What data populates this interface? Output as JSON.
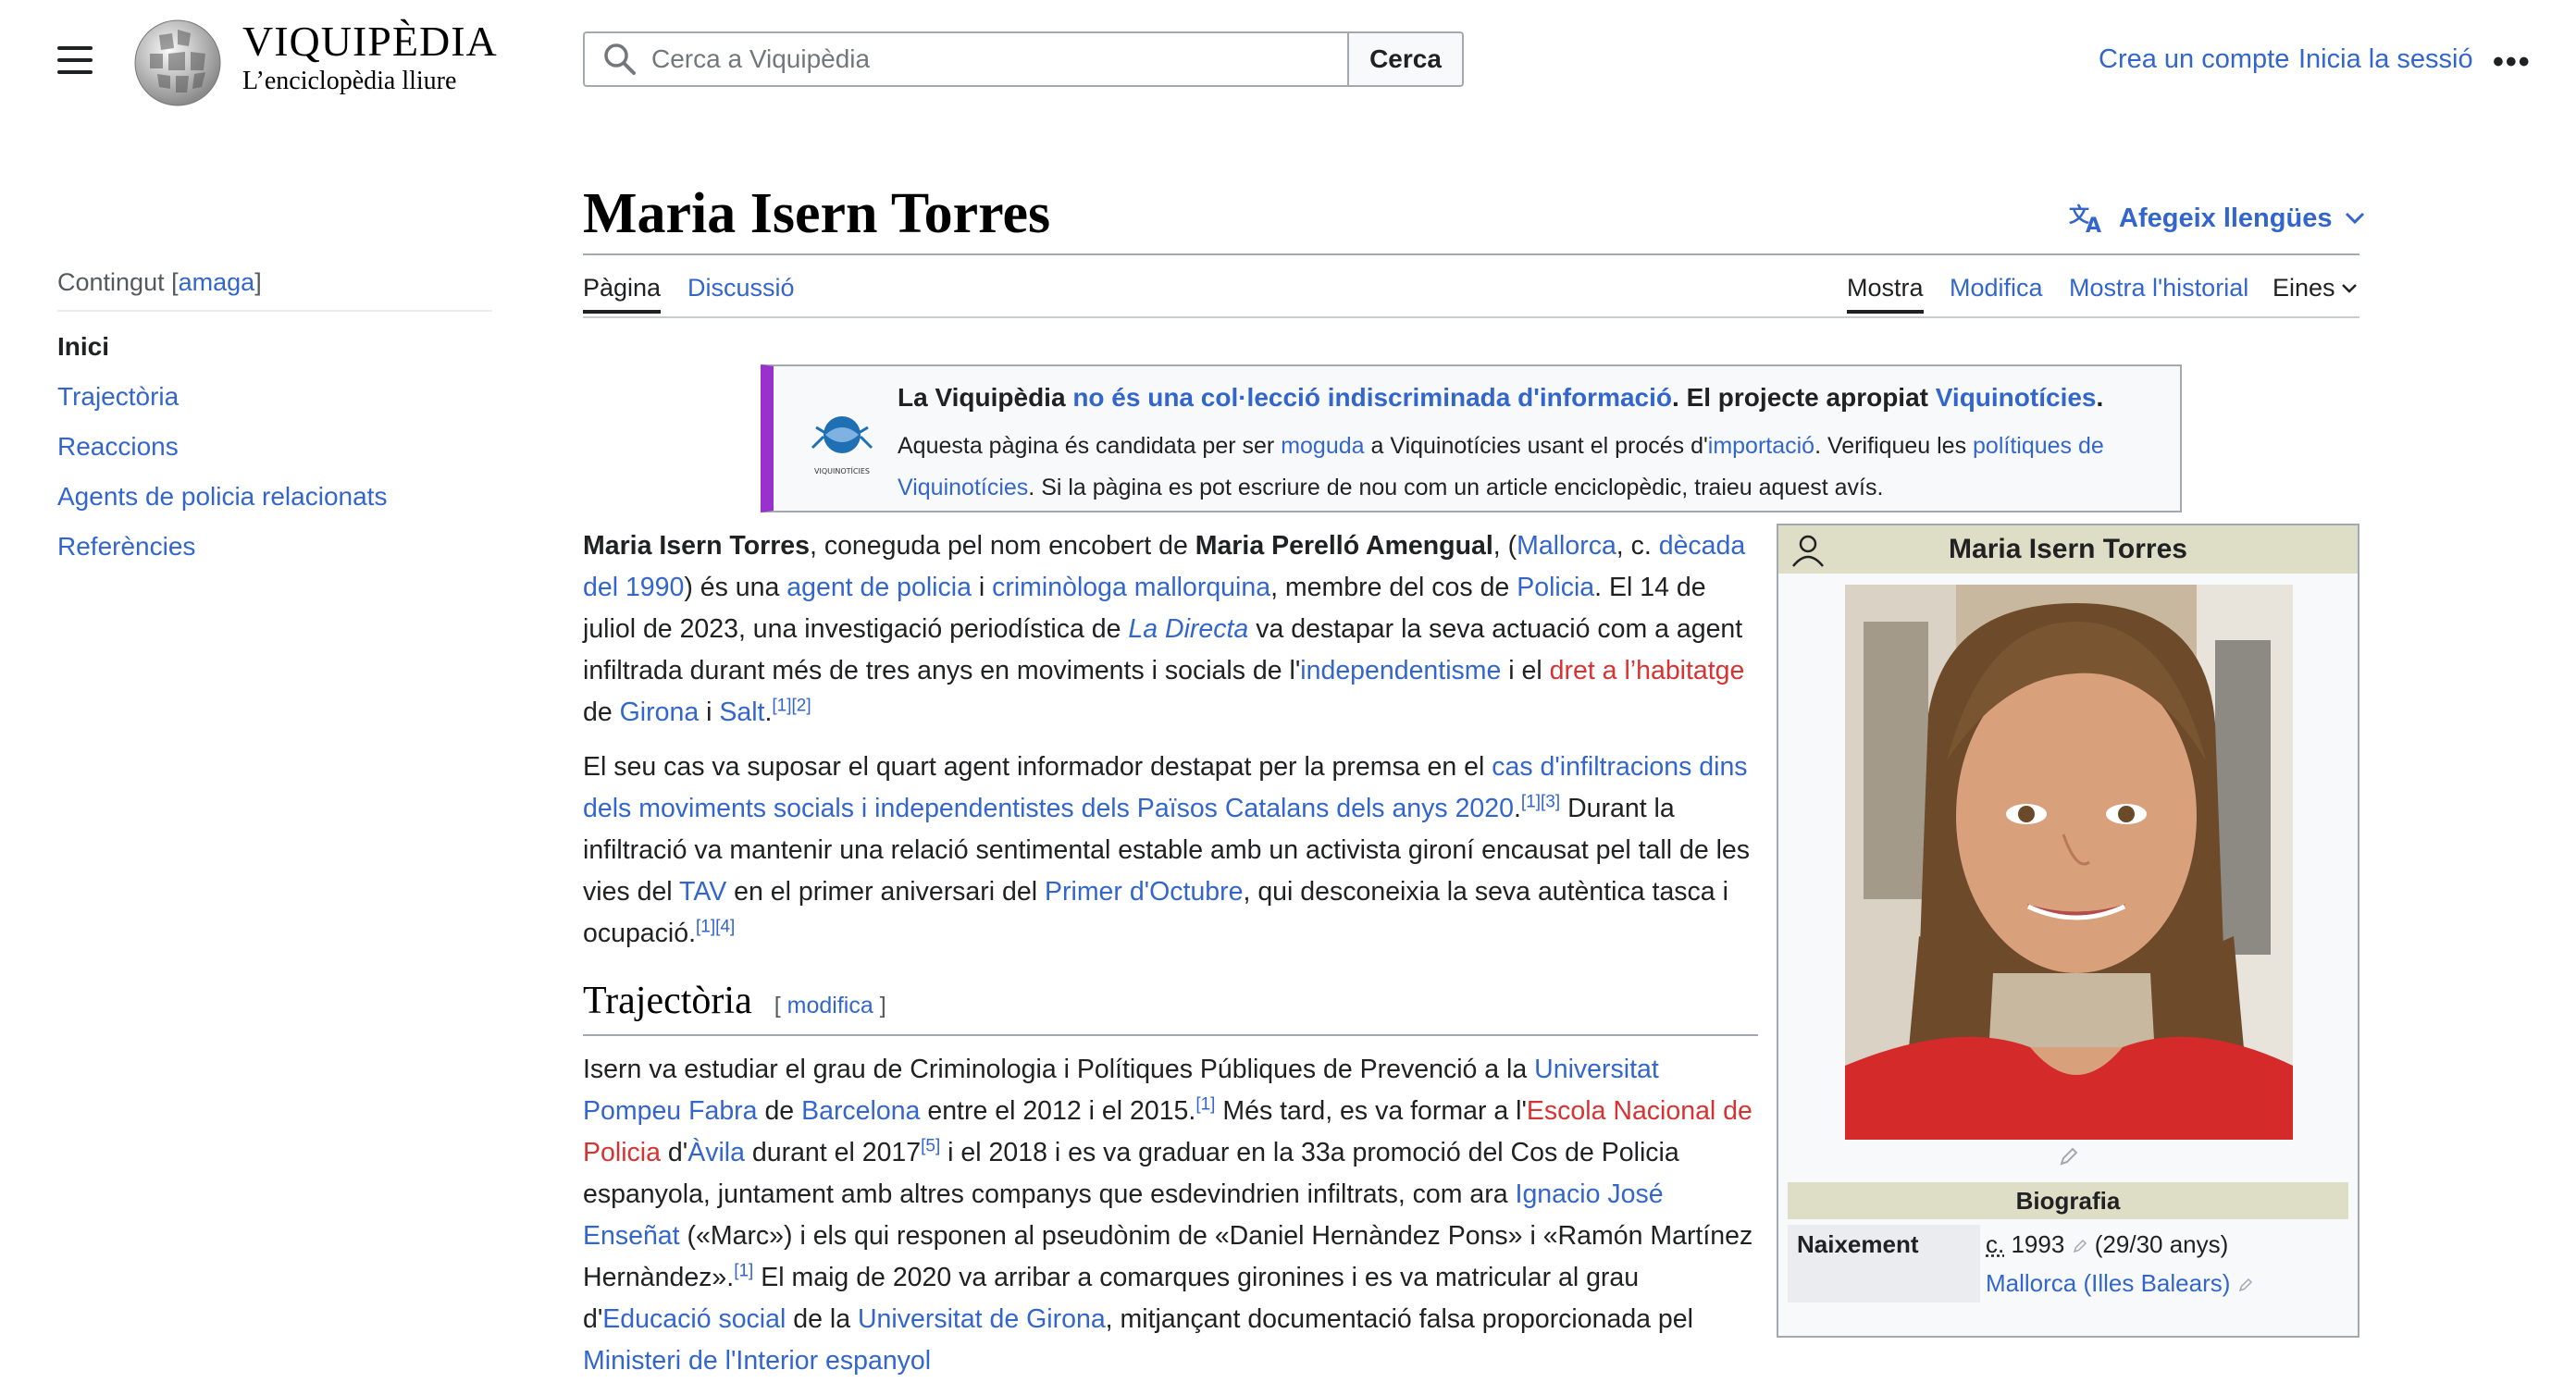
{
  "header": {
    "logo_title": "VIQUIPÈDIA",
    "logo_subtitle": "L’enciclopèdia lliure",
    "search_placeholder": "Cerca a Viquipèdia",
    "search_button": "Cerca",
    "create_account": "Crea un compte",
    "login": "Inicia la sessió",
    "more": "•••"
  },
  "toc": {
    "heading": "Contingut",
    "hide_open": "[",
    "hide": "amaga",
    "hide_close": "]",
    "items": [
      {
        "label": "Inici"
      },
      {
        "label": "Trajectòria"
      },
      {
        "label": "Reaccions"
      },
      {
        "label": "Agents de policia relacionats"
      },
      {
        "label": "Referències"
      }
    ]
  },
  "page": {
    "title": "Maria Isern Torres",
    "add_languages": "Afegeix llengües",
    "tabs": {
      "page": "Pàgina",
      "talk": "Discussió",
      "read": "Mostra",
      "edit": "Modifica",
      "history": "Mostra l'historial",
      "tools": "Eines"
    }
  },
  "notice": {
    "logo_text": "VIQUINOTÍCIES",
    "l1_a": "La Viquipèdia ",
    "l1_link": "no és una col·lecció indiscriminada d'informació",
    "l1_b": ". El projecte apropiat ",
    "l1_link2": "Viquinotícies",
    "l1_c": ".",
    "l2_a": "Aquesta pàgina és candidata per ser ",
    "l2_link1": "moguda",
    "l2_b": " a Viquinotícies usant el procés d'",
    "l2_link2": "importació",
    "l2_c": ". Verifiqueu les ",
    "l2_link3": "polítiques de Viquinotícies",
    "l2_d": ". Si la pàgina es pot escriure de nou com un article enciclopèdic, traieu aquest avís."
  },
  "p1": {
    "b1": "Maria Isern Torres",
    "t1": ", coneguda pel nom encobert de ",
    "b2": "Maria Perelló Amengual",
    "t2": ", (",
    "l1": "Mallorca",
    "t3": ", c. ",
    "l2": "dècada del 1990",
    "t4": ") és una ",
    "l3": "agent de policia",
    "t5": " i ",
    "l4": "criminòloga mallorquina",
    "t6": ", membre del cos de ",
    "l5": "Policia",
    "t7": ". El 14 de juliol de 2023, una investigació periodística de ",
    "l6": "La Directa",
    "t8": " va destapar la seva actuació com a agent infiltrada durant més de tres anys en moviments i socials de l'",
    "l7": "independentisme",
    "t9": " i el ",
    "r1": "dret a l’habitatge",
    "t10": " de ",
    "l8": "Girona",
    "t11": " i ",
    "l9": "Salt",
    "t12": ".",
    "s1": "[1]",
    "s2": "[2]"
  },
  "p2": {
    "t1": "El seu cas va suposar el quart agent informador destapat per la premsa en el ",
    "l1": "cas d'infiltracions dins dels moviments socials i independentistes dels Països Catalans dels anys 2020",
    "t2": ".",
    "s1": "[1]",
    "s2": "[3]",
    "t3": " Durant la infiltració va mantenir una relació sentimental estable amb un activista gironí encausat pel tall de les vies del ",
    "l2": "TAV",
    "t4": " en el primer aniversari del ",
    "l3": "Primer d'Octubre",
    "t5": ", qui desconeixia la seva autèntica tasca i ocupació.",
    "s3": "[1]",
    "s4": "[4]"
  },
  "section1": {
    "title": "Trajectòria",
    "edit_open": "[",
    "edit": "modifica",
    "edit_close": "]"
  },
  "p3": {
    "t1": "Isern va estudiar el grau de Criminologia i Polítiques Públiques de Prevenció a la ",
    "l1": "Universitat Pompeu Fabra",
    "t2": " de ",
    "l2": "Barcelona",
    "t3": " entre el 2012 i el 2015.",
    "s1": "[1]",
    "t4": " Més tard, es va formar a l'",
    "r1": "Escola Nacional de Policia",
    "t5": " d'",
    "l3": "Àvila",
    "t6": " durant el 2017",
    "s2": "[5]",
    "t7": " i el 2018 i es va graduar en la 33a promoció del Cos de Policia espanyola, juntament amb altres companys que esdevindrien infiltrats, com ara ",
    "l4": "Ignacio José Enseñat",
    "t8": " («Marc») i els qui responen al pseudònim de «Daniel Hernàndez Pons» i «Ramón Martínez Hernàndez».",
    "s3": "[1]",
    "t9": " El maig de 2020 va arribar a comarques gironines i es va matricular al grau d'",
    "l5": "Educació social",
    "t10": " de la ",
    "l6": "Universitat de Girona",
    "t11": ", mitjançant documentació falsa proporcionada pel ",
    "l7": "Ministeri de l'Interior espanyol"
  },
  "infobox": {
    "title": "Maria Isern Torres",
    "section": "Biografia",
    "birth_label": "Naixement",
    "birth_circa": "c.",
    "birth_year": " 1993",
    "birth_age": " (29/30 anys)",
    "birth_place": "Mallorca (Illes Balears)"
  },
  "colors": {
    "link": "#3366cc",
    "redlink": "#d73333",
    "notice_accent": "#9932cc",
    "infobox_header": "#deddc6"
  }
}
